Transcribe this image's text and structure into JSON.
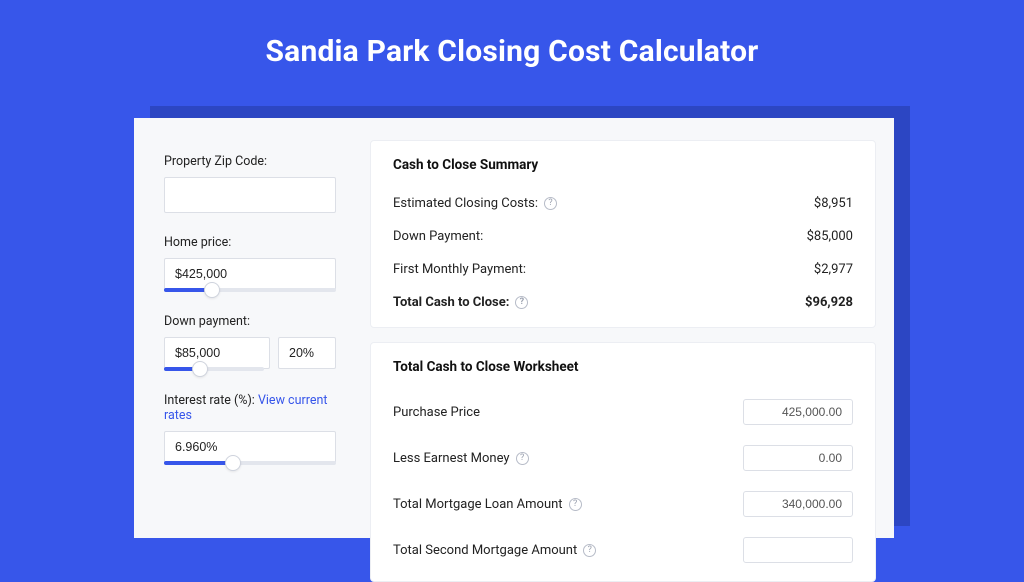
{
  "title": "Sandia Park Closing Cost Calculator",
  "sidebar": {
    "zip_label": "Property Zip Code:",
    "zip_value": "",
    "home_price_label": "Home price:",
    "home_price_value": "$425,000",
    "home_price_slider_pct": 28,
    "down_payment_label": "Down payment:",
    "down_payment_value": "$85,000",
    "down_payment_pct": "20%",
    "down_payment_slider_pct": 36,
    "rate_label_prefix": "Interest rate (%): ",
    "rate_link": "View current rates",
    "rate_value": "6.960%",
    "rate_slider_pct": 40
  },
  "summary": {
    "heading": "Cash to Close Summary",
    "rows": {
      "closing_costs_label": "Estimated Closing Costs:",
      "closing_costs_value": "$8,951",
      "down_payment_label": "Down Payment:",
      "down_payment_value": "$85,000",
      "first_payment_label": "First Monthly Payment:",
      "first_payment_value": "$2,977",
      "total_label": "Total Cash to Close:",
      "total_value": "$96,928"
    }
  },
  "worksheet": {
    "heading": "Total Cash to Close Worksheet",
    "rows": {
      "purchase_price_label": "Purchase Price",
      "purchase_price_value": "425,000.00",
      "earnest_label": "Less Earnest Money",
      "earnest_value": "0.00",
      "mortgage_label": "Total Mortgage Loan Amount",
      "mortgage_value": "340,000.00",
      "second_mortgage_label": "Total Second Mortgage Amount"
    }
  }
}
